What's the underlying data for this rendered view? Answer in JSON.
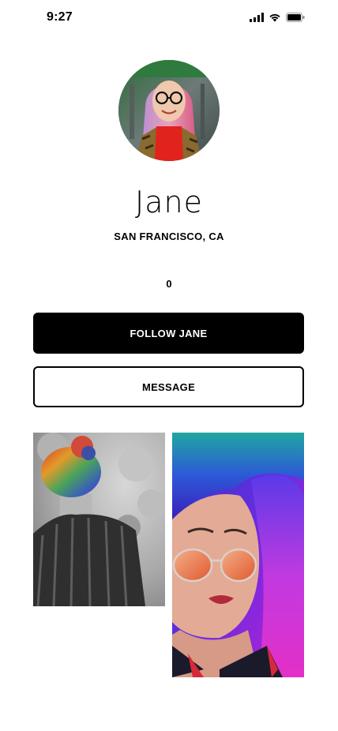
{
  "status_bar": {
    "time": "9:27",
    "icons": [
      "signal-icon",
      "wifi-icon",
      "battery-icon"
    ]
  },
  "profile": {
    "avatar": "avatar-photo",
    "name": "Jane",
    "location": "SAN FRANCISCO, CA",
    "follower_count": "0"
  },
  "actions": {
    "follow_label": "FOLLOW JANE",
    "message_label": "MESSAGE"
  },
  "gallery": {
    "photos": [
      "rainbow-hair-bun-photo",
      "colorful-hair-sunglasses-photo"
    ]
  },
  "colors": {
    "primary": "#000000",
    "background": "#ffffff",
    "on_primary": "#ffffff"
  }
}
